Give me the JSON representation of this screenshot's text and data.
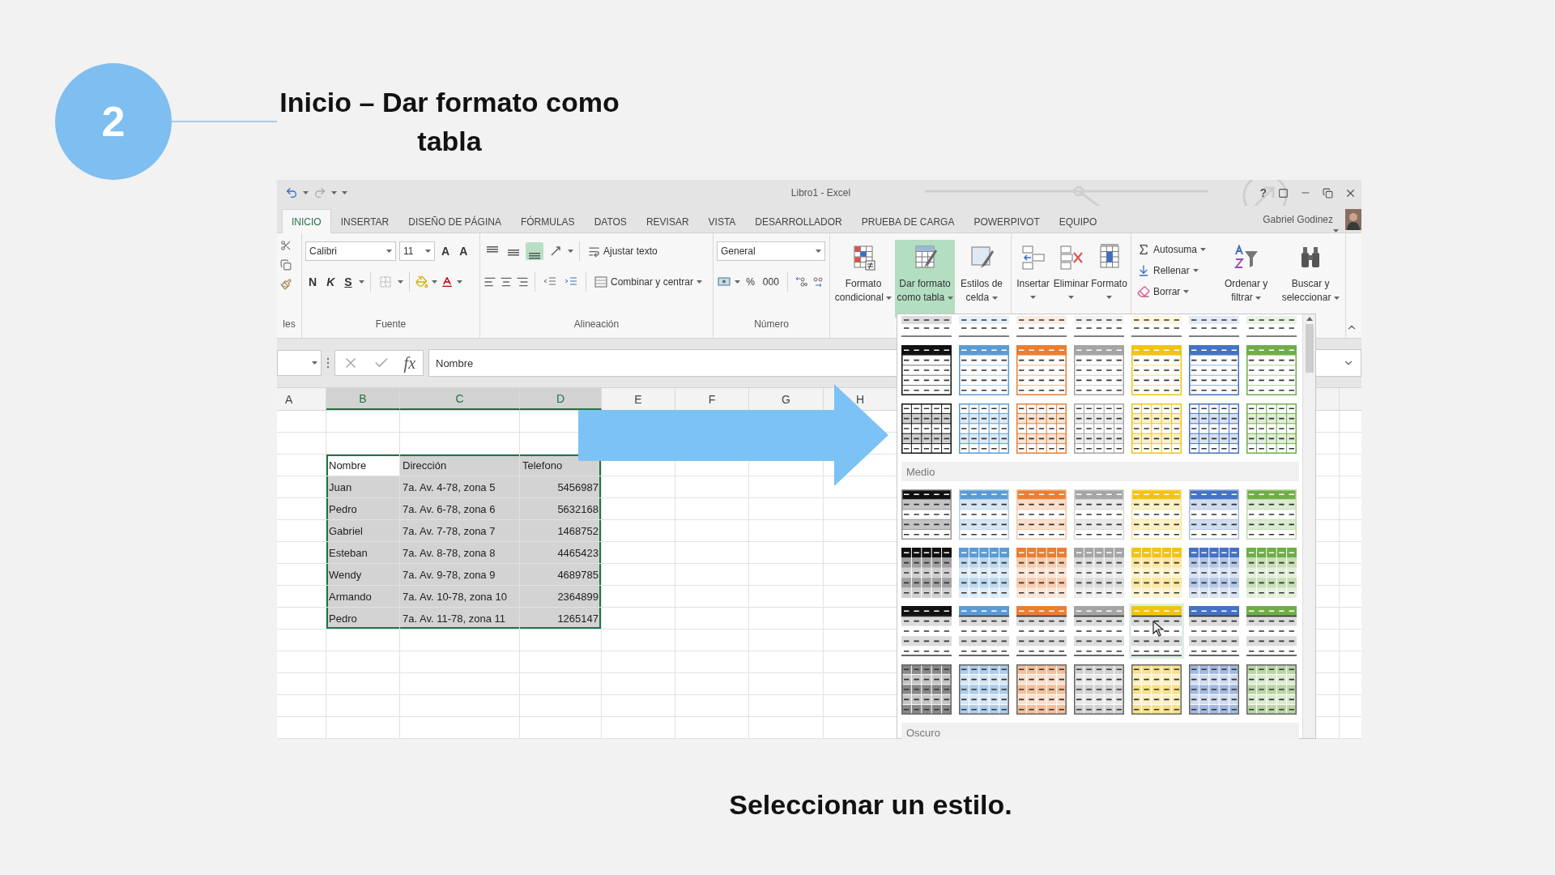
{
  "slide": {
    "step": "2",
    "title": "Inicio – Dar formato como tabla",
    "caption": "Seleccionar un estilo."
  },
  "excel": {
    "window_title": "Libro1 - Excel",
    "help": "?",
    "user": "Gabriel Godinez",
    "tabs": [
      {
        "label": "INICIO",
        "selected": true
      },
      {
        "label": "INSERTAR",
        "selected": false
      },
      {
        "label": "DISEÑO DE PÁGINA",
        "selected": false
      },
      {
        "label": "FÓRMULAS",
        "selected": false
      },
      {
        "label": "DATOS",
        "selected": false
      },
      {
        "label": "REVISAR",
        "selected": false
      },
      {
        "label": "VISTA",
        "selected": false
      },
      {
        "label": "DESARROLLADOR",
        "selected": false
      },
      {
        "label": "PRUEBA DE CARGA",
        "selected": false
      },
      {
        "label": "POWERPIVOT",
        "selected": false
      },
      {
        "label": "EQUIPO",
        "selected": false
      }
    ],
    "ribbon": {
      "clipboard_label": "les",
      "font": {
        "name": "Calibri",
        "size": "11",
        "grow": "A",
        "shrink": "A",
        "style_buttons": [
          "N",
          "K",
          "S"
        ],
        "label": "Fuente"
      },
      "alignment": {
        "vertical": [
          {
            "selected": false
          },
          {
            "selected": false
          },
          {
            "selected": true
          }
        ],
        "wrap": "Ajustar texto",
        "merge": "Combinar y centrar",
        "label": "Alineación"
      },
      "number": {
        "format": "General",
        "percent": "%",
        "thousands": "000",
        "label": "Número"
      },
      "styles": [
        {
          "kind": "conditional",
          "label": "Formato\ncondicional",
          "selected": false
        },
        {
          "kind": "table",
          "label": "Dar formato\ncomo tabla",
          "selected": true
        },
        {
          "kind": "cell",
          "label": "Estilos de\ncelda",
          "selected": false
        }
      ],
      "cells": [
        {
          "kind": "insert",
          "label": "Insertar"
        },
        {
          "kind": "delete",
          "label": "Eliminar"
        },
        {
          "kind": "format",
          "label": "Formato"
        }
      ],
      "editing": [
        {
          "kind": "sum",
          "label": "Autosuma"
        },
        {
          "kind": "fill",
          "label": "Rellenar"
        },
        {
          "kind": "clear",
          "label": "Borrar"
        }
      ],
      "tools": [
        {
          "kind": "sort",
          "label": "Ordenar y\nfiltrar"
        },
        {
          "kind": "find",
          "label": "Buscar y\nseleccionar"
        }
      ]
    },
    "formula_bar": {
      "function_label": "fx",
      "value": "Nombre"
    },
    "columns": [
      {
        "label": "A",
        "selected": false
      },
      {
        "label": "B",
        "selected": true
      },
      {
        "label": "C",
        "selected": true
      },
      {
        "label": "D",
        "selected": true
      },
      {
        "label": "E",
        "selected": false
      },
      {
        "label": "F",
        "selected": false
      },
      {
        "label": "G",
        "selected": false
      },
      {
        "label": "H",
        "selected": false
      }
    ],
    "table": {
      "selected": true,
      "header": [
        "Nombre",
        "Dirección",
        "Telefono"
      ],
      "records": [
        [
          "Juan",
          "7a. Av. 4-78, zona 5",
          "5456987"
        ],
        [
          "Pedro",
          "7a. Av. 6-78, zona 6",
          "5632168"
        ],
        [
          "Gabriel",
          "7a. Av. 7-78, zona 7",
          "1468752"
        ],
        [
          "Esteban",
          "7a. Av. 8-78, zona 8",
          "4465423"
        ],
        [
          "Wendy",
          "7a. Av. 9-78, zona 9",
          "4689785"
        ],
        [
          "Armando",
          "7a. Av. 10-78, zona 10",
          "2364899"
        ],
        [
          "Pedro",
          "7a. Av. 11-78, zona 11",
          "1265147"
        ]
      ]
    },
    "style_gallery": {
      "colors": [
        {
          "color": "#111111"
        },
        {
          "color": "#5b9bd5"
        },
        {
          "color": "#ed7d31"
        },
        {
          "color": "#a5a5a5"
        },
        {
          "color": "#f2c314"
        },
        {
          "color": "#4472c4"
        },
        {
          "color": "#70ad47"
        }
      ],
      "sections": [
        {
          "rows": [
            {
              "kind": "lines",
              "hovered": [
                false,
                false,
                false,
                false,
                false,
                false,
                false
              ]
            },
            {
              "kind": "header-lines",
              "hovered": [
                false,
                false,
                false,
                false,
                false,
                false,
                false
              ]
            },
            {
              "kind": "grid",
              "hovered": [
                false,
                false,
                false,
                false,
                false,
                false,
                false
              ]
            }
          ]
        },
        {
          "label": "Medio",
          "rows": [
            {
              "kind": "header-banded",
              "hovered": [
                false,
                false,
                false,
                false,
                false,
                false,
                false
              ]
            },
            {
              "kind": "header-banded-grid",
              "hovered": [
                false,
                false,
                false,
                false,
                false,
                false,
                false
              ]
            },
            {
              "kind": "header-rule",
              "hovered": [
                false,
                false,
                false,
                false,
                true,
                false,
                false
              ]
            },
            {
              "kind": "filled-grid",
              "hovered": [
                false,
                false,
                false,
                false,
                false,
                false,
                false
              ]
            }
          ]
        },
        {
          "label": "Oscuro"
        }
      ]
    }
  }
}
